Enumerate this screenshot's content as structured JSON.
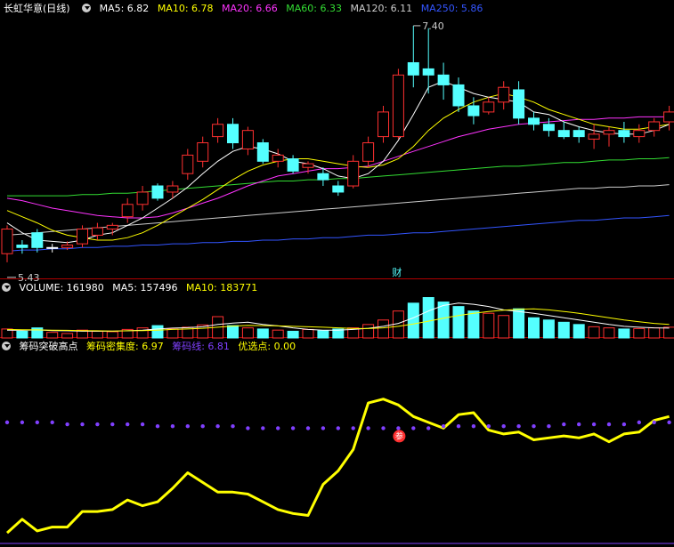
{
  "stock": {
    "name": "长虹华意",
    "period": "(日线)"
  },
  "price_panel": {
    "indicators": [
      {
        "label": "MA5: 6.82",
        "color": "#ffffff"
      },
      {
        "label": "MA10: 6.78",
        "color": "#ffff00"
      },
      {
        "label": "MA20: 6.66",
        "color": "#ff33ff"
      },
      {
        "label": "MA60: 6.33",
        "color": "#33dd33"
      },
      {
        "label": "MA120: 6.11",
        "color": "#cccccc"
      },
      {
        "label": "MA250: 5.86",
        "color": "#3355ff"
      }
    ],
    "high_label": "7.40",
    "low_label": "5.43",
    "marker": "财"
  },
  "volume_panel": {
    "title": "VOLUME: 161980",
    "ma5": "MA5: 157496",
    "ma10": "MA10: 183771"
  },
  "chip_panel": {
    "title": "筹码突破高点",
    "density": "筹码密集度: 6.97",
    "line": "筹码线: 6.81",
    "best": "优选点: 0.00",
    "marker": "参"
  },
  "colors": {
    "up": "#ff3030",
    "down": "#54ffff",
    "density": "#ffff00",
    "chipline": "#8040ff"
  },
  "candles": [
    [
      5.55,
      5.75,
      5.48,
      5.78
    ],
    [
      5.62,
      5.6,
      5.55,
      5.66
    ],
    [
      5.72,
      5.6,
      5.56,
      5.75
    ],
    [
      5.6,
      5.6,
      5.56,
      5.63
    ],
    [
      5.6,
      5.62,
      5.58,
      5.65
    ],
    [
      5.63,
      5.75,
      5.6,
      5.78
    ],
    [
      5.7,
      5.76,
      5.66,
      5.8
    ],
    [
      5.75,
      5.78,
      5.7,
      5.8
    ],
    [
      5.85,
      5.95,
      5.8,
      6.0
    ],
    [
      5.95,
      6.05,
      5.9,
      6.1
    ],
    [
      6.1,
      6.0,
      5.98,
      6.12
    ],
    [
      6.05,
      6.1,
      6.0,
      6.14
    ],
    [
      6.2,
      6.35,
      6.15,
      6.4
    ],
    [
      6.3,
      6.45,
      6.25,
      6.5
    ],
    [
      6.5,
      6.6,
      6.45,
      6.65
    ],
    [
      6.6,
      6.45,
      6.4,
      6.65
    ],
    [
      6.4,
      6.55,
      6.35,
      6.58
    ],
    [
      6.45,
      6.3,
      6.28,
      6.48
    ],
    [
      6.3,
      6.35,
      6.25,
      6.4
    ],
    [
      6.32,
      6.22,
      6.2,
      6.35
    ],
    [
      6.25,
      6.28,
      6.2,
      6.3
    ],
    [
      6.2,
      6.15,
      6.1,
      6.25
    ],
    [
      6.1,
      6.05,
      6.02,
      6.14
    ],
    [
      6.1,
      6.3,
      6.08,
      6.35
    ],
    [
      6.3,
      6.45,
      6.25,
      6.5
    ],
    [
      6.5,
      6.7,
      6.45,
      6.75
    ],
    [
      6.5,
      7.0,
      6.48,
      7.05
    ],
    [
      7.1,
      7.0,
      6.9,
      7.4
    ],
    [
      7.05,
      7.0,
      6.85,
      7.38
    ],
    [
      7.0,
      6.92,
      6.8,
      7.1
    ],
    [
      6.92,
      6.75,
      6.7,
      6.98
    ],
    [
      6.75,
      6.67,
      6.6,
      6.82
    ],
    [
      6.7,
      6.78,
      6.68,
      6.82
    ],
    [
      6.78,
      6.9,
      6.72,
      6.95
    ],
    [
      6.88,
      6.65,
      6.6,
      6.95
    ],
    [
      6.65,
      6.6,
      6.55,
      6.7
    ],
    [
      6.6,
      6.55,
      6.5,
      6.65
    ],
    [
      6.55,
      6.5,
      6.48,
      6.62
    ],
    [
      6.55,
      6.5,
      6.45,
      6.58
    ],
    [
      6.48,
      6.52,
      6.4,
      6.6
    ],
    [
      6.52,
      6.55,
      6.42,
      6.58
    ],
    [
      6.55,
      6.5,
      6.45,
      6.62
    ],
    [
      6.5,
      6.55,
      6.45,
      6.6
    ],
    [
      6.55,
      6.62,
      6.5,
      6.65
    ],
    [
      6.62,
      6.7,
      6.55,
      6.75
    ]
  ],
  "ma_series": {
    "ma5": [
      5.8,
      5.72,
      5.66,
      5.65,
      5.64,
      5.66,
      5.7,
      5.72,
      5.78,
      5.84,
      5.92,
      6.0,
      6.09,
      6.2,
      6.3,
      6.38,
      6.42,
      6.4,
      6.36,
      6.3,
      6.28,
      6.24,
      6.18,
      6.16,
      6.2,
      6.3,
      6.47,
      6.68,
      6.9,
      6.95,
      6.9,
      6.85,
      6.82,
      6.8,
      6.78,
      6.7,
      6.68,
      6.62,
      6.58,
      6.55,
      6.53,
      6.52,
      6.52,
      6.55,
      6.6
    ],
    "ma10": [
      5.9,
      5.85,
      5.8,
      5.74,
      5.7,
      5.68,
      5.66,
      5.66,
      5.68,
      5.72,
      5.78,
      5.85,
      5.92,
      5.99,
      6.07,
      6.15,
      6.22,
      6.27,
      6.3,
      6.32,
      6.32,
      6.3,
      6.28,
      6.26,
      6.25,
      6.27,
      6.32,
      6.42,
      6.55,
      6.65,
      6.72,
      6.78,
      6.82,
      6.85,
      6.82,
      6.78,
      6.72,
      6.68,
      6.64,
      6.6,
      6.58,
      6.56,
      6.56,
      6.58,
      6.6
    ],
    "ma20": [
      6.0,
      5.98,
      5.95,
      5.92,
      5.9,
      5.88,
      5.86,
      5.85,
      5.84,
      5.84,
      5.85,
      5.88,
      5.92,
      5.96,
      6.0,
      6.05,
      6.1,
      6.14,
      6.18,
      6.2,
      6.22,
      6.24,
      6.24,
      6.25,
      6.26,
      6.3,
      6.34,
      6.38,
      6.42,
      6.46,
      6.5,
      6.53,
      6.56,
      6.58,
      6.6,
      6.61,
      6.62,
      6.63,
      6.64,
      6.64,
      6.65,
      6.65,
      6.66,
      6.66,
      6.66
    ],
    "ma60": [
      6.02,
      6.02,
      6.02,
      6.02,
      6.02,
      6.03,
      6.03,
      6.04,
      6.04,
      6.05,
      6.06,
      6.07,
      6.08,
      6.09,
      6.1,
      6.11,
      6.12,
      6.13,
      6.14,
      6.14,
      6.15,
      6.15,
      6.16,
      6.16,
      6.17,
      6.18,
      6.19,
      6.2,
      6.21,
      6.22,
      6.23,
      6.24,
      6.25,
      6.26,
      6.26,
      6.27,
      6.28,
      6.29,
      6.29,
      6.3,
      6.31,
      6.31,
      6.32,
      6.32,
      6.33
    ],
    "ma120": [
      5.7,
      5.71,
      5.72,
      5.73,
      5.74,
      5.75,
      5.76,
      5.77,
      5.78,
      5.79,
      5.8,
      5.81,
      5.82,
      5.83,
      5.84,
      5.85,
      5.86,
      5.87,
      5.88,
      5.89,
      5.9,
      5.91,
      5.92,
      5.93,
      5.94,
      5.95,
      5.96,
      5.97,
      5.98,
      5.99,
      6.0,
      6.01,
      6.02,
      6.03,
      6.04,
      6.05,
      6.06,
      6.07,
      6.08,
      6.08,
      6.09,
      6.09,
      6.1,
      6.1,
      6.11
    ],
    "ma250": [
      5.57,
      5.58,
      5.58,
      5.59,
      5.59,
      5.6,
      5.6,
      5.61,
      5.61,
      5.62,
      5.62,
      5.63,
      5.63,
      5.64,
      5.64,
      5.65,
      5.65,
      5.66,
      5.66,
      5.67,
      5.67,
      5.68,
      5.68,
      5.69,
      5.7,
      5.7,
      5.71,
      5.72,
      5.72,
      5.73,
      5.74,
      5.75,
      5.76,
      5.77,
      5.78,
      5.79,
      5.8,
      5.81,
      5.82,
      5.82,
      5.83,
      5.84,
      5.84,
      5.85,
      5.86
    ]
  },
  "volume": {
    "bars": [
      40,
      30,
      45,
      25,
      20,
      35,
      30,
      28,
      38,
      45,
      55,
      40,
      48,
      58,
      95,
      55,
      45,
      40,
      35,
      30,
      38,
      32,
      40,
      45,
      60,
      80,
      120,
      155,
      180,
      160,
      140,
      120,
      110,
      100,
      130,
      90,
      80,
      70,
      60,
      50,
      45,
      40,
      42,
      45,
      48
    ],
    "ma5": [
      35,
      34,
      36,
      33,
      32,
      30,
      31,
      30,
      32,
      35,
      40,
      44,
      46,
      50,
      60,
      66,
      70,
      60,
      54,
      45,
      38,
      35,
      35,
      38,
      43,
      52,
      65,
      90,
      120,
      145,
      155,
      150,
      140,
      125,
      118,
      110,
      100,
      90,
      80,
      70,
      60,
      52,
      48,
      45,
      44
    ],
    "ma10": [
      38,
      37,
      36,
      35,
      34,
      33,
      32,
      31,
      32,
      33,
      35,
      38,
      40,
      43,
      48,
      53,
      56,
      55,
      54,
      52,
      50,
      48,
      45,
      42,
      42,
      45,
      52,
      62,
      75,
      88,
      100,
      110,
      118,
      124,
      128,
      130,
      125,
      118,
      110,
      100,
      90,
      80,
      72,
      65,
      60
    ]
  },
  "chip": {
    "density": [
      6.35,
      6.42,
      6.36,
      6.38,
      6.38,
      6.46,
      6.46,
      6.47,
      6.52,
      6.49,
      6.51,
      6.58,
      6.66,
      6.61,
      6.56,
      6.56,
      6.55,
      6.51,
      6.47,
      6.45,
      6.44,
      6.6,
      6.67,
      6.78,
      7.02,
      7.04,
      7.01,
      6.95,
      6.92,
      6.89,
      6.96,
      6.97,
      6.88,
      6.86,
      6.87,
      6.83,
      6.84,
      6.85,
      6.84,
      6.86,
      6.82,
      6.86,
      6.87,
      6.93,
      6.95
    ],
    "chipline": [
      6.92,
      6.92,
      6.92,
      6.92,
      6.91,
      6.91,
      6.91,
      6.91,
      6.91,
      6.91,
      6.9,
      6.9,
      6.9,
      6.9,
      6.9,
      6.9,
      6.89,
      6.89,
      6.89,
      6.89,
      6.89,
      6.89,
      6.89,
      6.89,
      6.89,
      6.89,
      6.89,
      6.89,
      6.89,
      6.9,
      6.9,
      6.9,
      6.9,
      6.9,
      6.9,
      6.9,
      6.9,
      6.91,
      6.91,
      6.91,
      6.91,
      6.91,
      6.92,
      6.92,
      6.92
    ]
  }
}
